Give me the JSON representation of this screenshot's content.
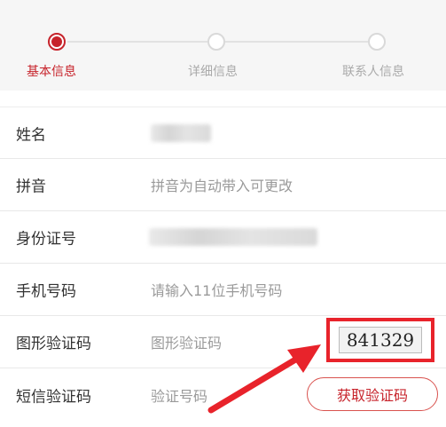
{
  "steps": [
    {
      "label": "基本信息",
      "state": "active"
    },
    {
      "label": "详细信息",
      "state": "inactive"
    },
    {
      "label": "联系人信息",
      "state": "inactive"
    }
  ],
  "form": {
    "name": {
      "label": "姓名",
      "value": ""
    },
    "pinyin": {
      "label": "拼音",
      "placeholder": "拼音为自动带入可更改"
    },
    "id_number": {
      "label": "身份证号",
      "value": ""
    },
    "phone": {
      "label": "手机号码",
      "placeholder": "请输入11位手机号码"
    },
    "captcha": {
      "label": "图形验证码",
      "placeholder": "图形验证码",
      "image_text": "841329"
    },
    "sms": {
      "label": "短信验证码",
      "placeholder": "验证号码",
      "button_label": "获取验证码"
    }
  },
  "colors": {
    "accent": "#c7232b",
    "highlight": "#e8232b",
    "inactive": "#d9d9d9"
  }
}
